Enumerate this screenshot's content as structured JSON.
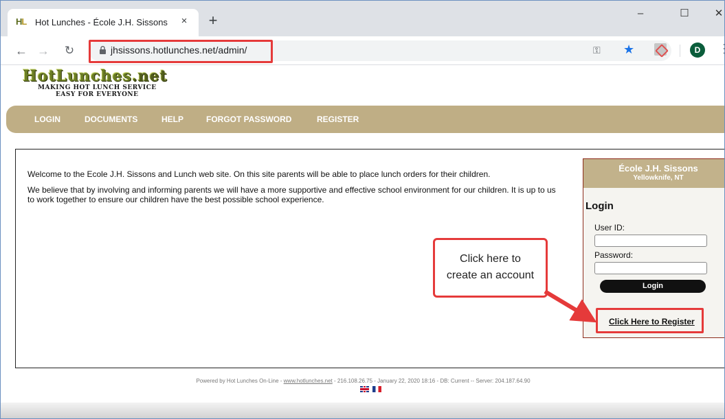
{
  "browser": {
    "tab": {
      "title": "Hot Lunches - École J.H. Sissons",
      "favicon_text": "HL",
      "close_glyph": "×"
    },
    "new_tab_glyph": "+",
    "window_controls": {
      "minimize": "–",
      "maximize": "☐",
      "close": "✕"
    },
    "nav": {
      "back": "←",
      "forward": "→",
      "reload": "C"
    },
    "url": "jhsissons.hotlunches.net/admin/",
    "icons": {
      "key": "key-icon",
      "star": "star-icon",
      "pdf": "pdf-icon",
      "menu": "kebab-menu-icon"
    },
    "profile_initial": "D",
    "accent_color": "#1a73e8"
  },
  "site": {
    "logo": {
      "main": "HotLunches",
      "suffix": ".net",
      "tagline_1": "MAKING HOT LUNCH SERVICE",
      "tagline_2": "EASY FOR EVERYONE"
    },
    "nav_items": [
      "LOGIN",
      "DOCUMENTS",
      "HELP",
      "FORGOT PASSWORD",
      "REGISTER"
    ],
    "nav_color": "#bfae85",
    "welcome": [
      "Welcome to the Ecole J.H. Sissons and Lunch web site. On this site parents will be able to place lunch orders for their children.",
      "We believe that by involving and informing parents we will have a more supportive and effective school environment for our children. It is up to us to work together to ensure our children have the best possible school experience."
    ],
    "school": {
      "name": "École J.H. Sissons",
      "location": "Yellowknife, NT"
    },
    "login": {
      "heading": "Login",
      "userid_label": "User ID:",
      "password_label": "Password:",
      "button": "Login",
      "register_link": "Click Here to Register"
    },
    "callout": {
      "line1": "Click here to",
      "line2": "create an account"
    },
    "highlight_color": "#e53a3a",
    "footer": {
      "prefix": "Powered by Hot Lunches On-Line - ",
      "link": "www.hotlunches.net",
      "suffix": " - 216.108.26.75 - January 22, 2020 18:16 - DB: Current -- Server: 204.187.64.90"
    },
    "flags": [
      "flag-uk-icon",
      "flag-fr-icon"
    ]
  }
}
